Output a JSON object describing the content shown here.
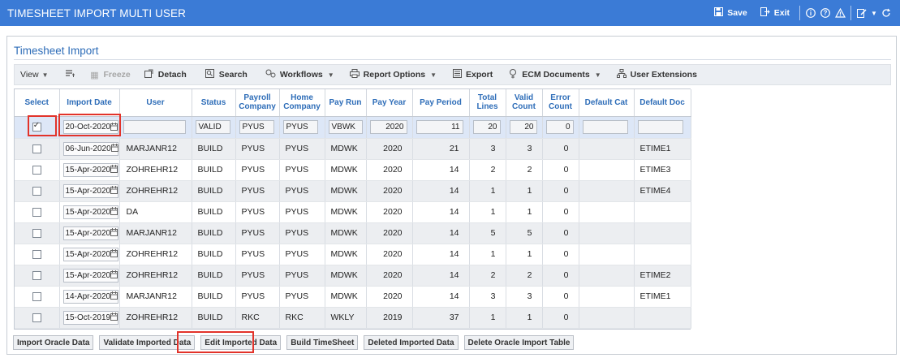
{
  "window": {
    "title": "TIMESHEET IMPORT MULTI USER",
    "save_label": "Save",
    "exit_label": "Exit"
  },
  "panel": {
    "title": "Timesheet Import"
  },
  "toolbar": {
    "view": "View",
    "freeze": "Freeze",
    "detach": "Detach",
    "search": "Search",
    "workflows": "Workflows",
    "report_options": "Report Options",
    "export": "Export",
    "ecm_documents": "ECM Documents",
    "user_extensions": "User Extensions"
  },
  "grid": {
    "headers": {
      "select": "Select",
      "import_date": "Import Date",
      "user": "User",
      "status": "Status",
      "payroll_company_1": "Payroll",
      "payroll_company_2": "Company",
      "home_company_1": "Home",
      "home_company_2": "Company",
      "pay_run": "Pay Run",
      "pay_year": "Pay Year",
      "pay_period": "Pay Period",
      "total_lines_1": "Total",
      "total_lines_2": "Lines",
      "valid_count_1": "Valid",
      "valid_count_2": "Count",
      "error_count_1": "Error",
      "error_count_2": "Count",
      "default_cat": "Default Cat",
      "default_doc": "Default Doc"
    },
    "edit_row": {
      "selected": true,
      "import_date": "20-Oct-2020",
      "user": "",
      "status": "VALID",
      "payroll_company": "PYUS",
      "home_company": "PYUS",
      "pay_run": "VBWK",
      "pay_year": "2020",
      "pay_period": "11",
      "total_lines": "20",
      "valid_count": "20",
      "error_count": "0",
      "default_cat": "",
      "default_doc": ""
    },
    "rows": [
      {
        "selected": false,
        "import_date": "06-Jun-2020",
        "user": "MARJANR12",
        "status": "BUILD",
        "payroll_company": "PYUS",
        "home_company": "PYUS",
        "pay_run": "MDWK",
        "pay_year": "2020",
        "pay_period": "21",
        "total_lines": "3",
        "valid_count": "3",
        "error_count": "0",
        "default_cat": "",
        "default_doc": "ETIME1"
      },
      {
        "selected": false,
        "import_date": "15-Apr-2020",
        "user": "ZOHREHR12",
        "status": "BUILD",
        "payroll_company": "PYUS",
        "home_company": "PYUS",
        "pay_run": "MDWK",
        "pay_year": "2020",
        "pay_period": "14",
        "total_lines": "2",
        "valid_count": "2",
        "error_count": "0",
        "default_cat": "",
        "default_doc": "ETIME3"
      },
      {
        "selected": false,
        "import_date": "15-Apr-2020",
        "user": "ZOHREHR12",
        "status": "BUILD",
        "payroll_company": "PYUS",
        "home_company": "PYUS",
        "pay_run": "MDWK",
        "pay_year": "2020",
        "pay_period": "14",
        "total_lines": "1",
        "valid_count": "1",
        "error_count": "0",
        "default_cat": "",
        "default_doc": "ETIME4"
      },
      {
        "selected": false,
        "import_date": "15-Apr-2020",
        "user": "DA",
        "status": "BUILD",
        "payroll_company": "PYUS",
        "home_company": "PYUS",
        "pay_run": "MDWK",
        "pay_year": "2020",
        "pay_period": "14",
        "total_lines": "1",
        "valid_count": "1",
        "error_count": "0",
        "default_cat": "",
        "default_doc": ""
      },
      {
        "selected": false,
        "import_date": "15-Apr-2020",
        "user": "MARJANR12",
        "status": "BUILD",
        "payroll_company": "PYUS",
        "home_company": "PYUS",
        "pay_run": "MDWK",
        "pay_year": "2020",
        "pay_period": "14",
        "total_lines": "5",
        "valid_count": "5",
        "error_count": "0",
        "default_cat": "",
        "default_doc": ""
      },
      {
        "selected": false,
        "import_date": "15-Apr-2020",
        "user": "ZOHREHR12",
        "status": "BUILD",
        "payroll_company": "PYUS",
        "home_company": "PYUS",
        "pay_run": "MDWK",
        "pay_year": "2020",
        "pay_period": "14",
        "total_lines": "1",
        "valid_count": "1",
        "error_count": "0",
        "default_cat": "",
        "default_doc": ""
      },
      {
        "selected": false,
        "import_date": "15-Apr-2020",
        "user": "ZOHREHR12",
        "status": "BUILD",
        "payroll_company": "PYUS",
        "home_company": "PYUS",
        "pay_run": "MDWK",
        "pay_year": "2020",
        "pay_period": "14",
        "total_lines": "2",
        "valid_count": "2",
        "error_count": "0",
        "default_cat": "",
        "default_doc": "ETIME2"
      },
      {
        "selected": false,
        "import_date": "14-Apr-2020",
        "user": "MARJANR12",
        "status": "BUILD",
        "payroll_company": "PYUS",
        "home_company": "PYUS",
        "pay_run": "MDWK",
        "pay_year": "2020",
        "pay_period": "14",
        "total_lines": "3",
        "valid_count": "3",
        "error_count": "0",
        "default_cat": "",
        "default_doc": "ETIME1"
      },
      {
        "selected": false,
        "import_date": "15-Oct-2019",
        "user": "ZOHREHR12",
        "status": "BUILD",
        "payroll_company": "RKC",
        "home_company": "RKC",
        "pay_run": "WKLY",
        "pay_year": "2019",
        "pay_period": "37",
        "total_lines": "1",
        "valid_count": "1",
        "error_count": "0",
        "default_cat": "",
        "default_doc": ""
      }
    ]
  },
  "buttons": {
    "import_oracle": "Import Oracle Data",
    "validate": "Validate Imported Data",
    "edit": "Edit Imported Data",
    "build": "Build TimeSheet",
    "deleted": "Deleted Imported Data",
    "delete_table": "Delete Oracle Import Table"
  },
  "colors": {
    "titlebar": "#3b7bd6",
    "header_text": "#2e6db8",
    "highlight": "#e2332a"
  }
}
